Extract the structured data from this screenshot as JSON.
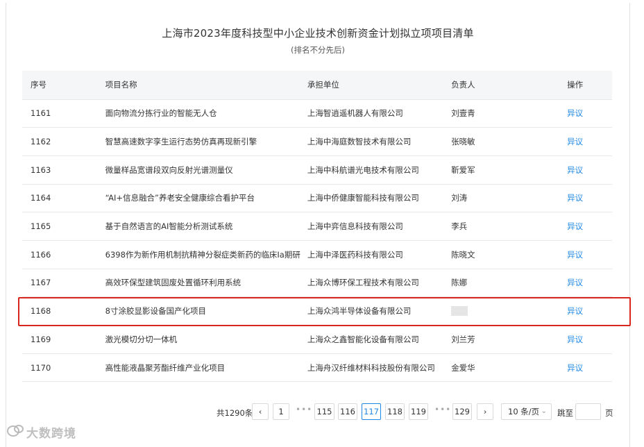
{
  "header": {
    "title": "上海市2023年度科技型中小企业技术创新资金计划拟立项项目清单",
    "subtitle": "(排名不分先后)"
  },
  "table": {
    "columns": [
      "序号",
      "项目名称",
      "承担单位",
      "负责人",
      "操作"
    ],
    "rows": [
      {
        "no": "1161",
        "name": "面向物流分拣行业的智能无人仓",
        "org": "上海智逍遥机器人有限公司",
        "person": "刘壹青",
        "action": "异议",
        "masked": false
      },
      {
        "no": "1162",
        "name": "智慧高速数字孪生运行态势仿真再现新引擎",
        "org": "上海中海庭数智技术有限公司",
        "person": "张晓敏",
        "action": "异议",
        "masked": false
      },
      {
        "no": "1163",
        "name": "微量样品宽谱段双向反射光谱测量仪",
        "org": "上海中科航谱光电技术有限公司",
        "person": "靳爱军",
        "action": "异议",
        "masked": false
      },
      {
        "no": "1164",
        "name": "“AI+信息融合”养老安全健康综合看护平台",
        "org": "上海中侨健康智能科技有限公司",
        "person": "刘涛",
        "action": "异议",
        "masked": false
      },
      {
        "no": "1165",
        "name": "基于自然语言的AI智能分析测试系统",
        "org": "上海中弈信息科技有限公司",
        "person": "李兵",
        "action": "异议",
        "masked": false
      },
      {
        "no": "1166",
        "name": "6398作为新作用机制抗精神分裂症类新药的临床Ia期研",
        "org": "上海中泽医药科技有限公司",
        "person": "陈晓文",
        "action": "异议",
        "masked": false
      },
      {
        "no": "1167",
        "name": "高效环保型建筑固废处置循环利用系统",
        "org": "上海众博环保工程技术有限公司",
        "person": "陈娜",
        "action": "异议",
        "masked": false
      },
      {
        "no": "1168",
        "name": "8寸涂胶显影设备国产化项目",
        "org": "上海众鸿半导体设备有限公司",
        "person": "",
        "action": "异议",
        "masked": true
      },
      {
        "no": "1169",
        "name": "激光模切分切一体机",
        "org": "上海众之鑫智能化设备有限公司",
        "person": "刘兰芳",
        "action": "异议",
        "masked": false
      },
      {
        "no": "1170",
        "name": "高性能液晶聚芳酯纤维产业化项目",
        "org": "上海舟汉纤维材料科技股份有限公司",
        "person": "金爱华",
        "action": "异议",
        "masked": false
      }
    ]
  },
  "pagination": {
    "total_text": "共1290条",
    "prev_symbol": "‹",
    "next_symbol": "›",
    "pages": [
      "1",
      "115",
      "116",
      "117",
      "118",
      "119",
      "129"
    ],
    "current_page": "117",
    "ellipsis": "•••",
    "page_size_text": "10 条/页",
    "page_size_chevron": "⌄",
    "jump_label": "跳至",
    "page_suffix": "页"
  },
  "watermark": {
    "text": "大数跨境"
  },
  "colors": {
    "link": "#1e88e5",
    "highlight_border": "#d9251c",
    "header_bg": "#f5f6f7"
  }
}
